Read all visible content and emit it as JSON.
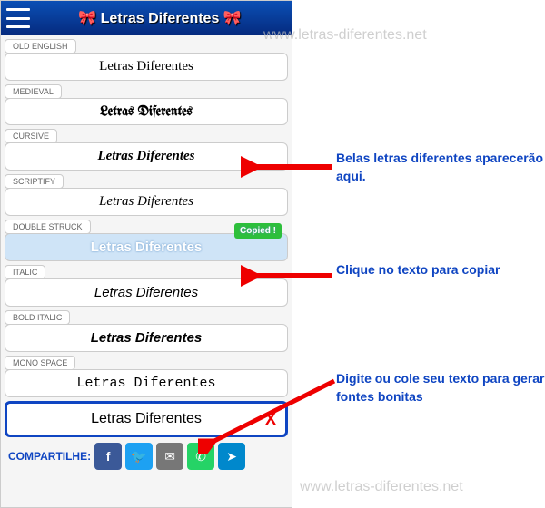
{
  "header": {
    "title": "🎀 Letras Diferentes 🎀"
  },
  "rows": [
    {
      "label": "OLD ENGLISH",
      "text": "Letras Diferentes",
      "klass": "old-english"
    },
    {
      "label": "MEDIEVAL",
      "text": "Letras Diferentes",
      "klass": "medieval"
    },
    {
      "label": "CURSIVE",
      "text": "Letras Diferentes",
      "klass": "cursive"
    },
    {
      "label": "SCRIPTIFY",
      "text": "Letras Diferentes",
      "klass": "scriptify"
    },
    {
      "label": "DOUBLE STRUCK",
      "text": "Letras Diferentes",
      "klass": "highlighted",
      "copied": "Copied !"
    },
    {
      "label": "ITALIC",
      "text": "Letras Diferentes",
      "klass": "italic"
    },
    {
      "label": "BOLD ITALIC",
      "text": "Letras Diferentes",
      "klass": "bold-italic"
    },
    {
      "label": "MONO SPACE",
      "text": "Letras Diferentes",
      "klass": "monospace"
    }
  ],
  "input": {
    "value": "Letras Diferentes",
    "clear": "X"
  },
  "share": {
    "label": "COMPARTILHE:",
    "icons": [
      "f",
      "🐦",
      "✉",
      "✆",
      "➤"
    ]
  },
  "annotations": {
    "a1": "Belas letras diferentes aparecerão aqui.",
    "a2": "Clique no texto para copiar",
    "a3": "Digite ou cole seu texto para gerar fontes bonitas"
  },
  "watermark": "www.letras-diferentes.net"
}
